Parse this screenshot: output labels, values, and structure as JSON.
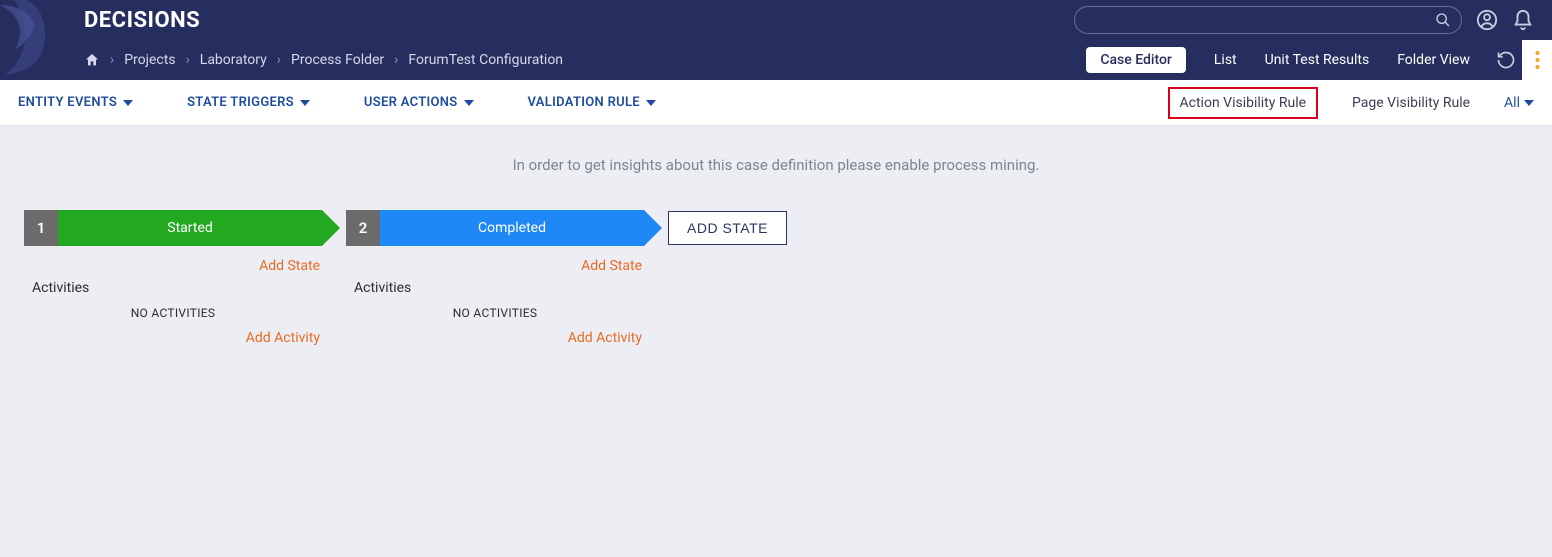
{
  "app": {
    "title": "DECISIONS"
  },
  "breadcrumb": {
    "items": [
      "Projects",
      "Laboratory",
      "Process Folder",
      "ForumTest Configuration"
    ]
  },
  "view_tabs": {
    "items": [
      {
        "label": "Case Editor",
        "active": true
      },
      {
        "label": "List"
      },
      {
        "label": "Unit Test Results"
      },
      {
        "label": "Folder View"
      }
    ]
  },
  "subnav": {
    "left": [
      "ENTITY EVENTS",
      "STATE TRIGGERS",
      "USER ACTIONS",
      "VALIDATION RULE"
    ],
    "right": {
      "action_visibility": "Action Visibility Rule",
      "page_visibility": "Page Visibility Rule",
      "all": "All"
    }
  },
  "info": "In order to get insights about this case definition please enable process mining.",
  "states": [
    {
      "num": "1",
      "label": "Started",
      "color": "green",
      "add_state": "Add State",
      "activities_label": "Activities",
      "no_activities": "NO ACTIVITIES",
      "add_activity": "Add Activity"
    },
    {
      "num": "2",
      "label": "Completed",
      "color": "blue",
      "add_state": "Add State",
      "activities_label": "Activities",
      "no_activities": "NO ACTIVITIES",
      "add_activity": "Add Activity"
    }
  ],
  "add_state_button": "ADD STATE"
}
